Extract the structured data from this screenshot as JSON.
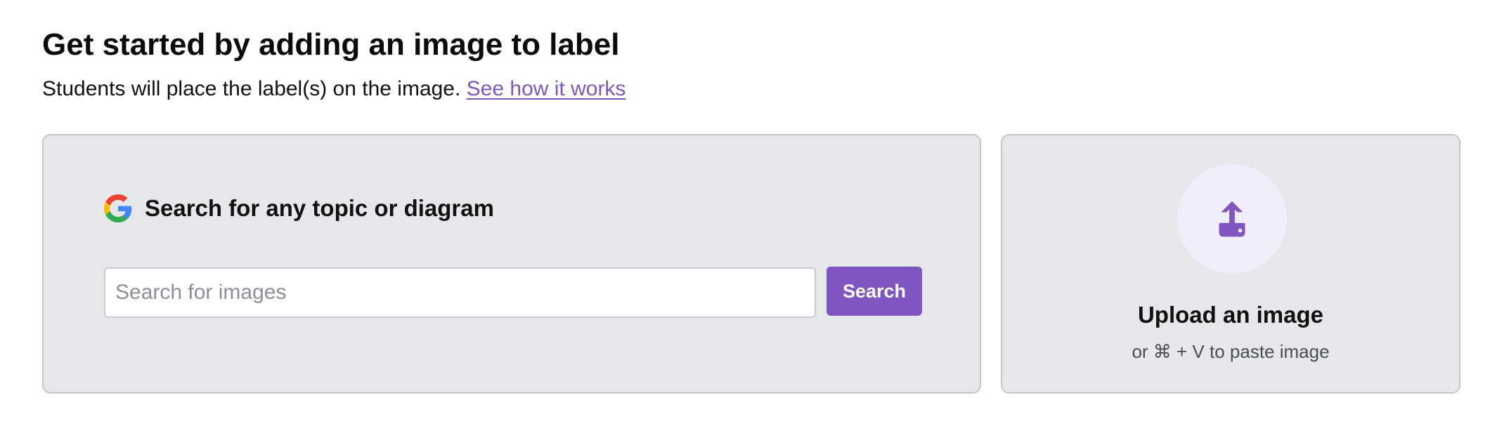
{
  "header": {
    "title": "Get started by adding an image to label",
    "subtitle": "Students will place the label(s) on the image. ",
    "help_link": "See how it works"
  },
  "search_panel": {
    "icon": "google-g-icon",
    "heading": "Search for any topic or diagram",
    "input_value": "",
    "input_placeholder": "Search for images",
    "button_label": "Search"
  },
  "upload_panel": {
    "icon": "upload-icon",
    "title": "Upload an image",
    "hint": "or ⌘ + V to paste image"
  },
  "colors": {
    "accent": "#7f56c0",
    "link": "#7c57bf",
    "card_background": "#e6e7eb",
    "card_border": "#c4c6cc",
    "upload_circle": "#f1edfa"
  }
}
